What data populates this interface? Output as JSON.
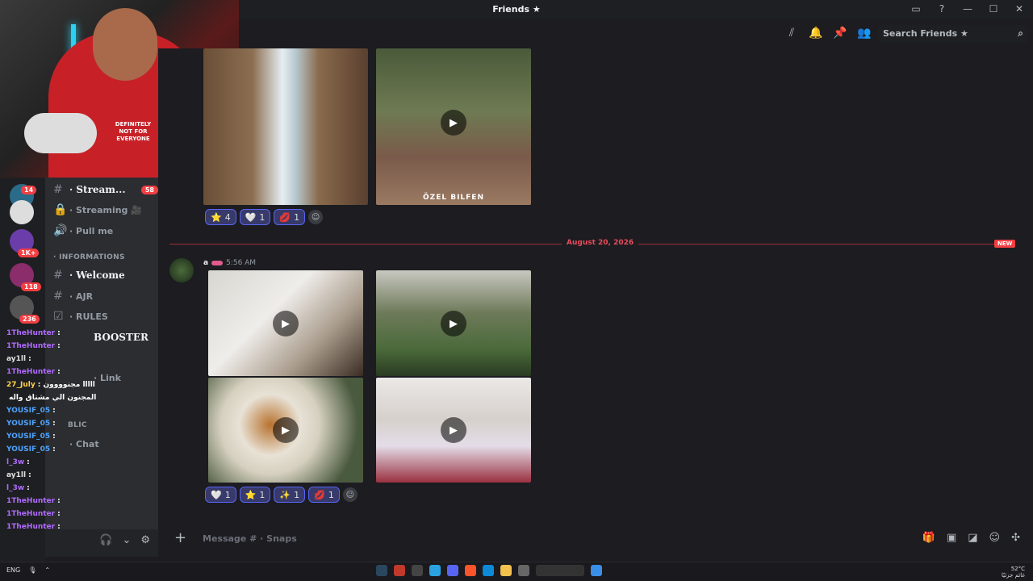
{
  "window": {
    "title": "Friends ★"
  },
  "toolbar": {
    "search_placeholder": "Search Friends ★"
  },
  "webcam": {
    "shirt_text": "DEFINITELY NOT FOR EVERYONE"
  },
  "servers": {
    "badges": [
      "14",
      "1K+",
      "118",
      "236"
    ]
  },
  "channels": {
    "items": [
      {
        "label": "· Stream...",
        "count": "58"
      },
      {
        "label": "· Streaming 🎥"
      },
      {
        "label": "· Pull me"
      }
    ],
    "category_info": "· INFORMATIONS",
    "info_items": [
      {
        "label": "· Welcome"
      },
      {
        "label": "· AJR"
      },
      {
        "label": "· RULES"
      },
      {
        "label": "BOOSTER"
      },
      {
        "label": "· Link"
      },
      {
        "label": "· Chat"
      }
    ],
    "category_public": "BLIC"
  },
  "stream_chat": [
    {
      "user": "1TheHunter",
      "msg": ":"
    },
    {
      "user": "1TheHunter",
      "msg": ":"
    },
    {
      "user": "ay1ll",
      "msg": ":"
    },
    {
      "user": "1TheHunter",
      "msg": ":"
    },
    {
      "user": "27_July",
      "msg": ": ااااا مجنوووون"
    },
    {
      "user": "",
      "msg": "المجنون الي مشتاق واله"
    },
    {
      "user": "YOUSIF_05",
      "msg": ":"
    },
    {
      "user": "YOUSIF_05",
      "msg": ":"
    },
    {
      "user": "YOUSIF_05",
      "msg": ":"
    },
    {
      "user": "YOUSIF_05",
      "msg": ":"
    },
    {
      "user": "l_3w",
      "msg": ":"
    },
    {
      "user": "ay1ll",
      "msg": ":"
    },
    {
      "user": "l_3w",
      "msg": ":"
    },
    {
      "user": "1TheHunter",
      "msg": ":"
    },
    {
      "user": "1TheHunter",
      "msg": ":"
    },
    {
      "user": "1TheHunter",
      "msg": ":"
    }
  ],
  "messages": {
    "first": {
      "tiles": [
        {
          "caption": ""
        },
        {
          "caption": "ÖZEL BILFEN"
        }
      ],
      "reactions": [
        {
          "emoji": "⭐",
          "count": "4",
          "me": true
        },
        {
          "emoji": "🤍",
          "count": "1",
          "me": true
        },
        {
          "emoji": "💋",
          "count": "1",
          "me": true
        }
      ]
    },
    "divider": {
      "date": "August 20, 2026",
      "badge": "NEW"
    },
    "second": {
      "author": "a",
      "time": "5:56 AM",
      "reactions": [
        {
          "emoji": "🤍",
          "count": "1",
          "me": true
        },
        {
          "emoji": "⭐",
          "count": "1",
          "me": true
        },
        {
          "emoji": "✨",
          "count": "1",
          "me": true
        },
        {
          "emoji": "💋",
          "count": "1",
          "me": true
        }
      ]
    }
  },
  "composer": {
    "placeholder": "Message # · Snaps"
  },
  "taskbar": {
    "lang": "ENG",
    "weather": "52°C",
    "weather_label": "غائم جزئيًا"
  }
}
